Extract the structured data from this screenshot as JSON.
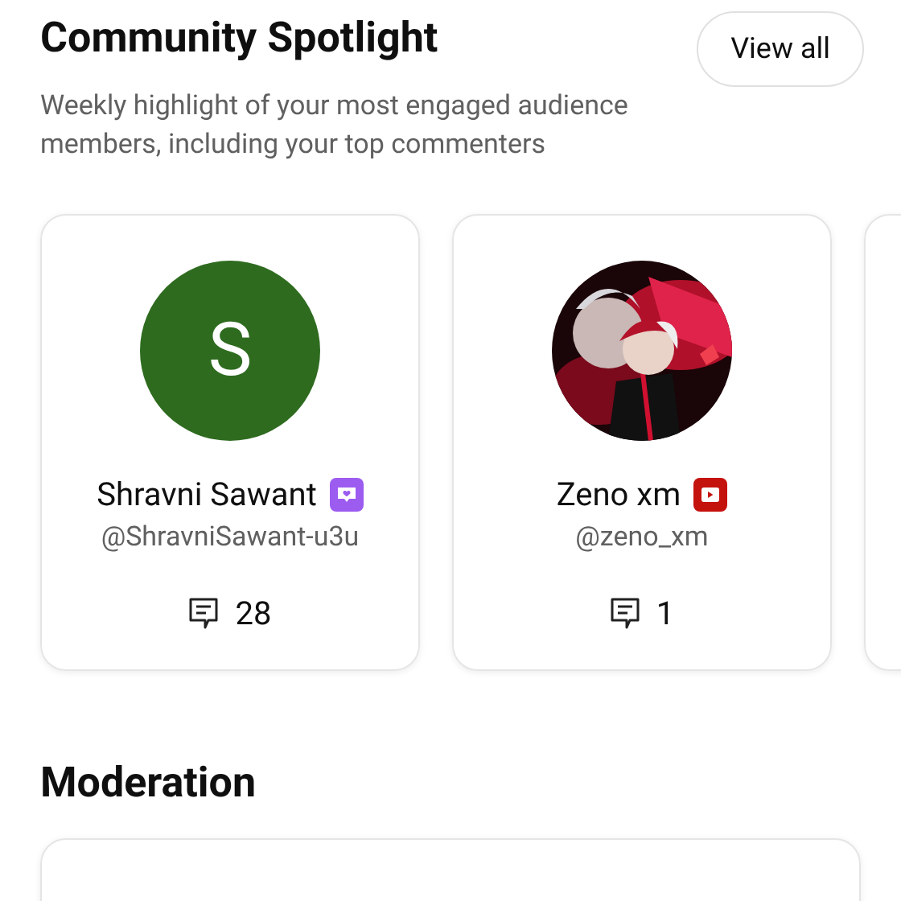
{
  "spotlight": {
    "title": "Community Spotlight",
    "button": "View all",
    "subtitle": "Weekly highlight of your most engaged audience members, including your top commenters",
    "cards": [
      {
        "avatar": {
          "kind": "letter",
          "letter": "S",
          "color": "#2e6b1f"
        },
        "name": "Shravni Sawant",
        "badge": {
          "kind": "member"
        },
        "handle": "@ShravniSawant-u3u",
        "comments": "28"
      },
      {
        "name": "Zeno xm",
        "badge": {
          "kind": "channel"
        },
        "handle": "@zeno_xm",
        "comments": "1"
      }
    ]
  },
  "moderation": {
    "title": "Moderation"
  }
}
